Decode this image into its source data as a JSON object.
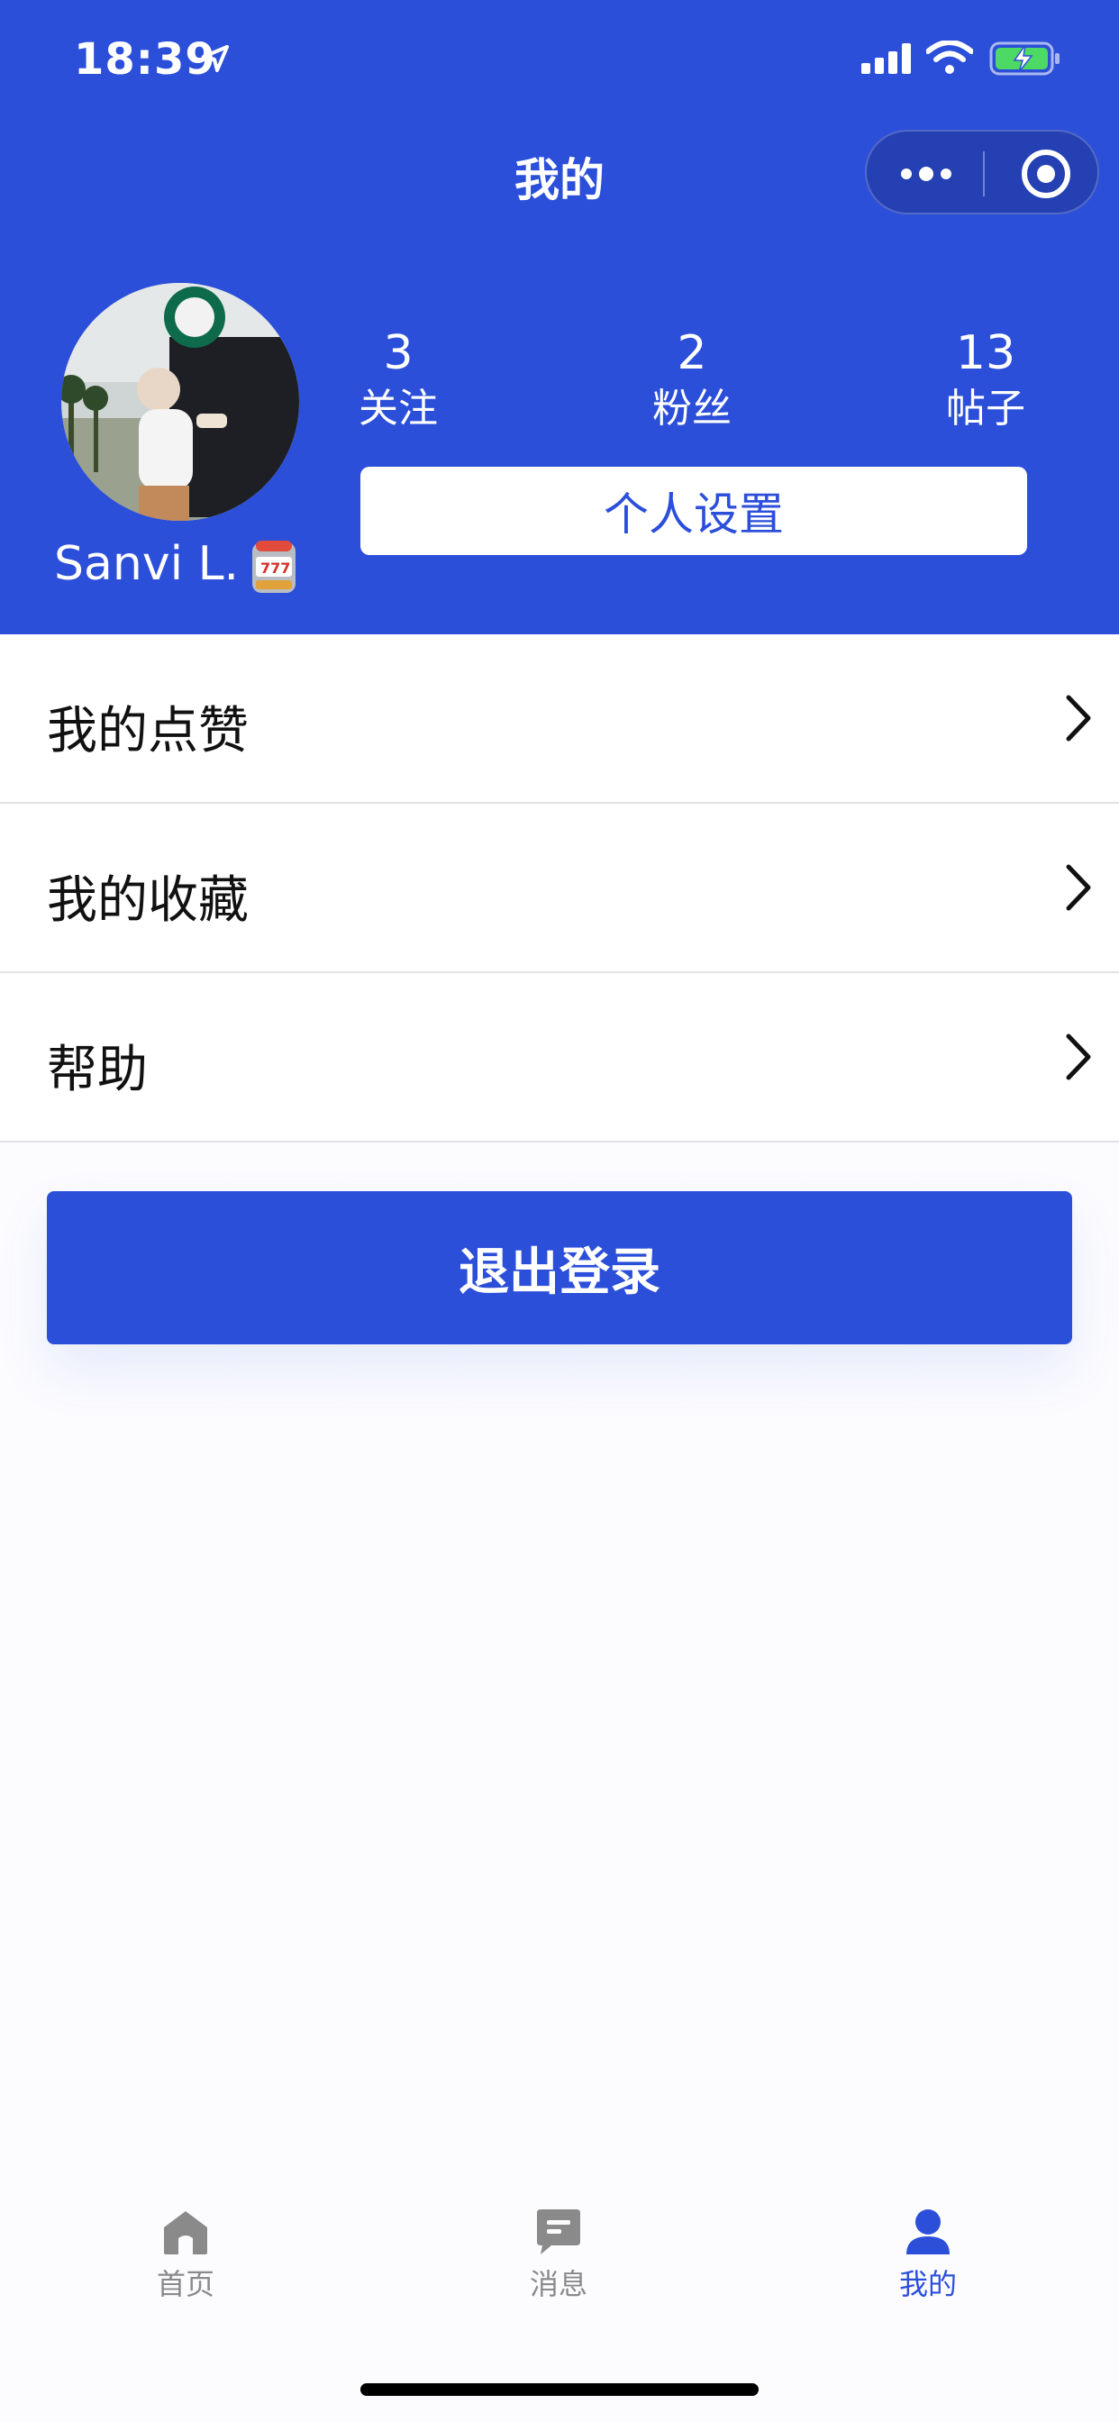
{
  "status_bar": {
    "time": "18:39"
  },
  "nav": {
    "title": "我的"
  },
  "profile": {
    "username": "Sanvi L.",
    "stats": [
      {
        "value": "3",
        "label": "关注"
      },
      {
        "value": "2",
        "label": "粉丝"
      },
      {
        "value": "13",
        "label": "帖子"
      }
    ],
    "settings_label": "个人设置"
  },
  "menu": {
    "items": [
      {
        "label": "我的点赞"
      },
      {
        "label": "我的收藏"
      },
      {
        "label": "帮助"
      }
    ]
  },
  "logout_label": "退出登录",
  "tabbar": {
    "items": [
      {
        "label": "首页",
        "icon": "home-icon",
        "active": false
      },
      {
        "label": "消息",
        "icon": "message-icon",
        "active": false
      },
      {
        "label": "我的",
        "icon": "user-icon",
        "active": true
      }
    ]
  },
  "colors": {
    "brand": "#2c4fda",
    "inactive_tab": "#8a8a8a",
    "background": "#fcfcff"
  }
}
